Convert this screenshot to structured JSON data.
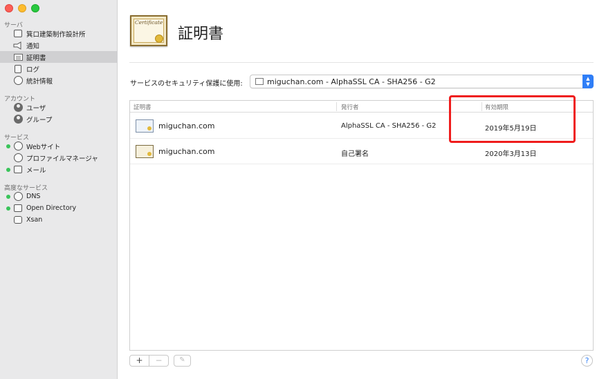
{
  "sidebar": {
    "groups": [
      {
        "title": "サーバ"
      },
      {
        "title": "アカウント"
      },
      {
        "title": "サービス"
      },
      {
        "title": "高度なサービス"
      }
    ],
    "items": [
      {
        "label": "箕口建築制作設計所",
        "icon": "server-icon"
      },
      {
        "label": "通知",
        "icon": "megaphone-icon"
      },
      {
        "label": "証明書",
        "icon": "certificate-icon",
        "selected": true
      },
      {
        "label": "ログ",
        "icon": "log-icon"
      },
      {
        "label": "統計情報",
        "icon": "stats-icon"
      },
      {
        "label": "ユーザ",
        "icon": "user-icon"
      },
      {
        "label": "グループ",
        "icon": "group-icon"
      },
      {
        "label": "Webサイト",
        "icon": "globe-icon",
        "active": true
      },
      {
        "label": "プロファイルマネージャ",
        "icon": "profile-icon"
      },
      {
        "label": "メール",
        "icon": "mail-icon",
        "active": true
      },
      {
        "label": "DNS",
        "icon": "dns-icon",
        "active": true
      },
      {
        "label": "Open Directory",
        "icon": "directory-icon",
        "active": true
      },
      {
        "label": "Xsan",
        "icon": "xsan-icon"
      }
    ]
  },
  "main": {
    "title": "証明書",
    "service_label": "サービスのセキュリティ保護に使用:",
    "service_value": "miguchan.com - AlphaSSL CA - SHA256 - G2",
    "table": {
      "headers": [
        "証明書",
        "発行者",
        "有効期限"
      ],
      "rows": [
        {
          "name": "miguchan.com",
          "issuer": "AlphaSSL CA - SHA256 - G2",
          "expires": "2019年5月19日"
        },
        {
          "name": "miguchan.com",
          "issuer": "自己署名",
          "expires": "2020年3月13日"
        }
      ]
    },
    "buttons": {
      "add": "+",
      "remove": "−",
      "edit": "✎",
      "help": "?"
    },
    "header_icon_text": "Certificate"
  },
  "colors": {
    "highlight": "#ef1c1c",
    "accent": "#2f7ef7",
    "status_dot": "#39c45a"
  }
}
